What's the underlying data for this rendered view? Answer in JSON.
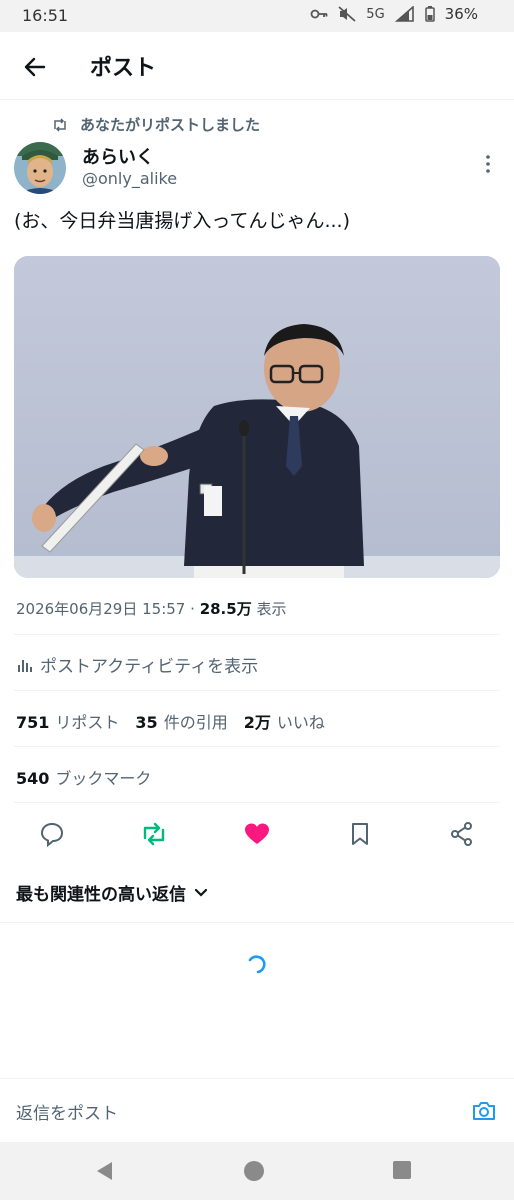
{
  "status_bar": {
    "time": "16:51",
    "network": "5G",
    "battery": "36%"
  },
  "header": {
    "title": "ポスト"
  },
  "post": {
    "repost_notice": "あなたがリポストしました",
    "author": {
      "display_name": "あらいく",
      "handle": "@only_alike"
    },
    "text": "(お、今日弁当唐揚げ入ってんじゃん...)",
    "timestamp": "2026年06月29日 15:57",
    "separator": "·",
    "views_count": "28.5万",
    "views_label": "表示",
    "activity_label": "ポストアクティビティを表示",
    "stats": {
      "reposts_count": "751",
      "reposts_label": "リポスト",
      "quotes_count": "35",
      "quotes_label": "件の引用",
      "likes_count": "2万",
      "likes_label": "いいね"
    },
    "bookmarks_count": "540",
    "bookmarks_label": "ブックマーク"
  },
  "actions": {
    "reply_icon": "comment-icon",
    "repost_icon": "repost-icon",
    "like_icon": "heart-icon",
    "bookmark_icon": "bookmark-icon",
    "share_icon": "share-icon",
    "repost_active_color": "#00ba7c",
    "like_active_color": "#f91880"
  },
  "replies": {
    "sort_label": "最も関連性の高い返信"
  },
  "composer": {
    "placeholder": "返信をポスト"
  },
  "colors": {
    "accent": "#1d9bf0",
    "secondary_text": "#536471"
  }
}
